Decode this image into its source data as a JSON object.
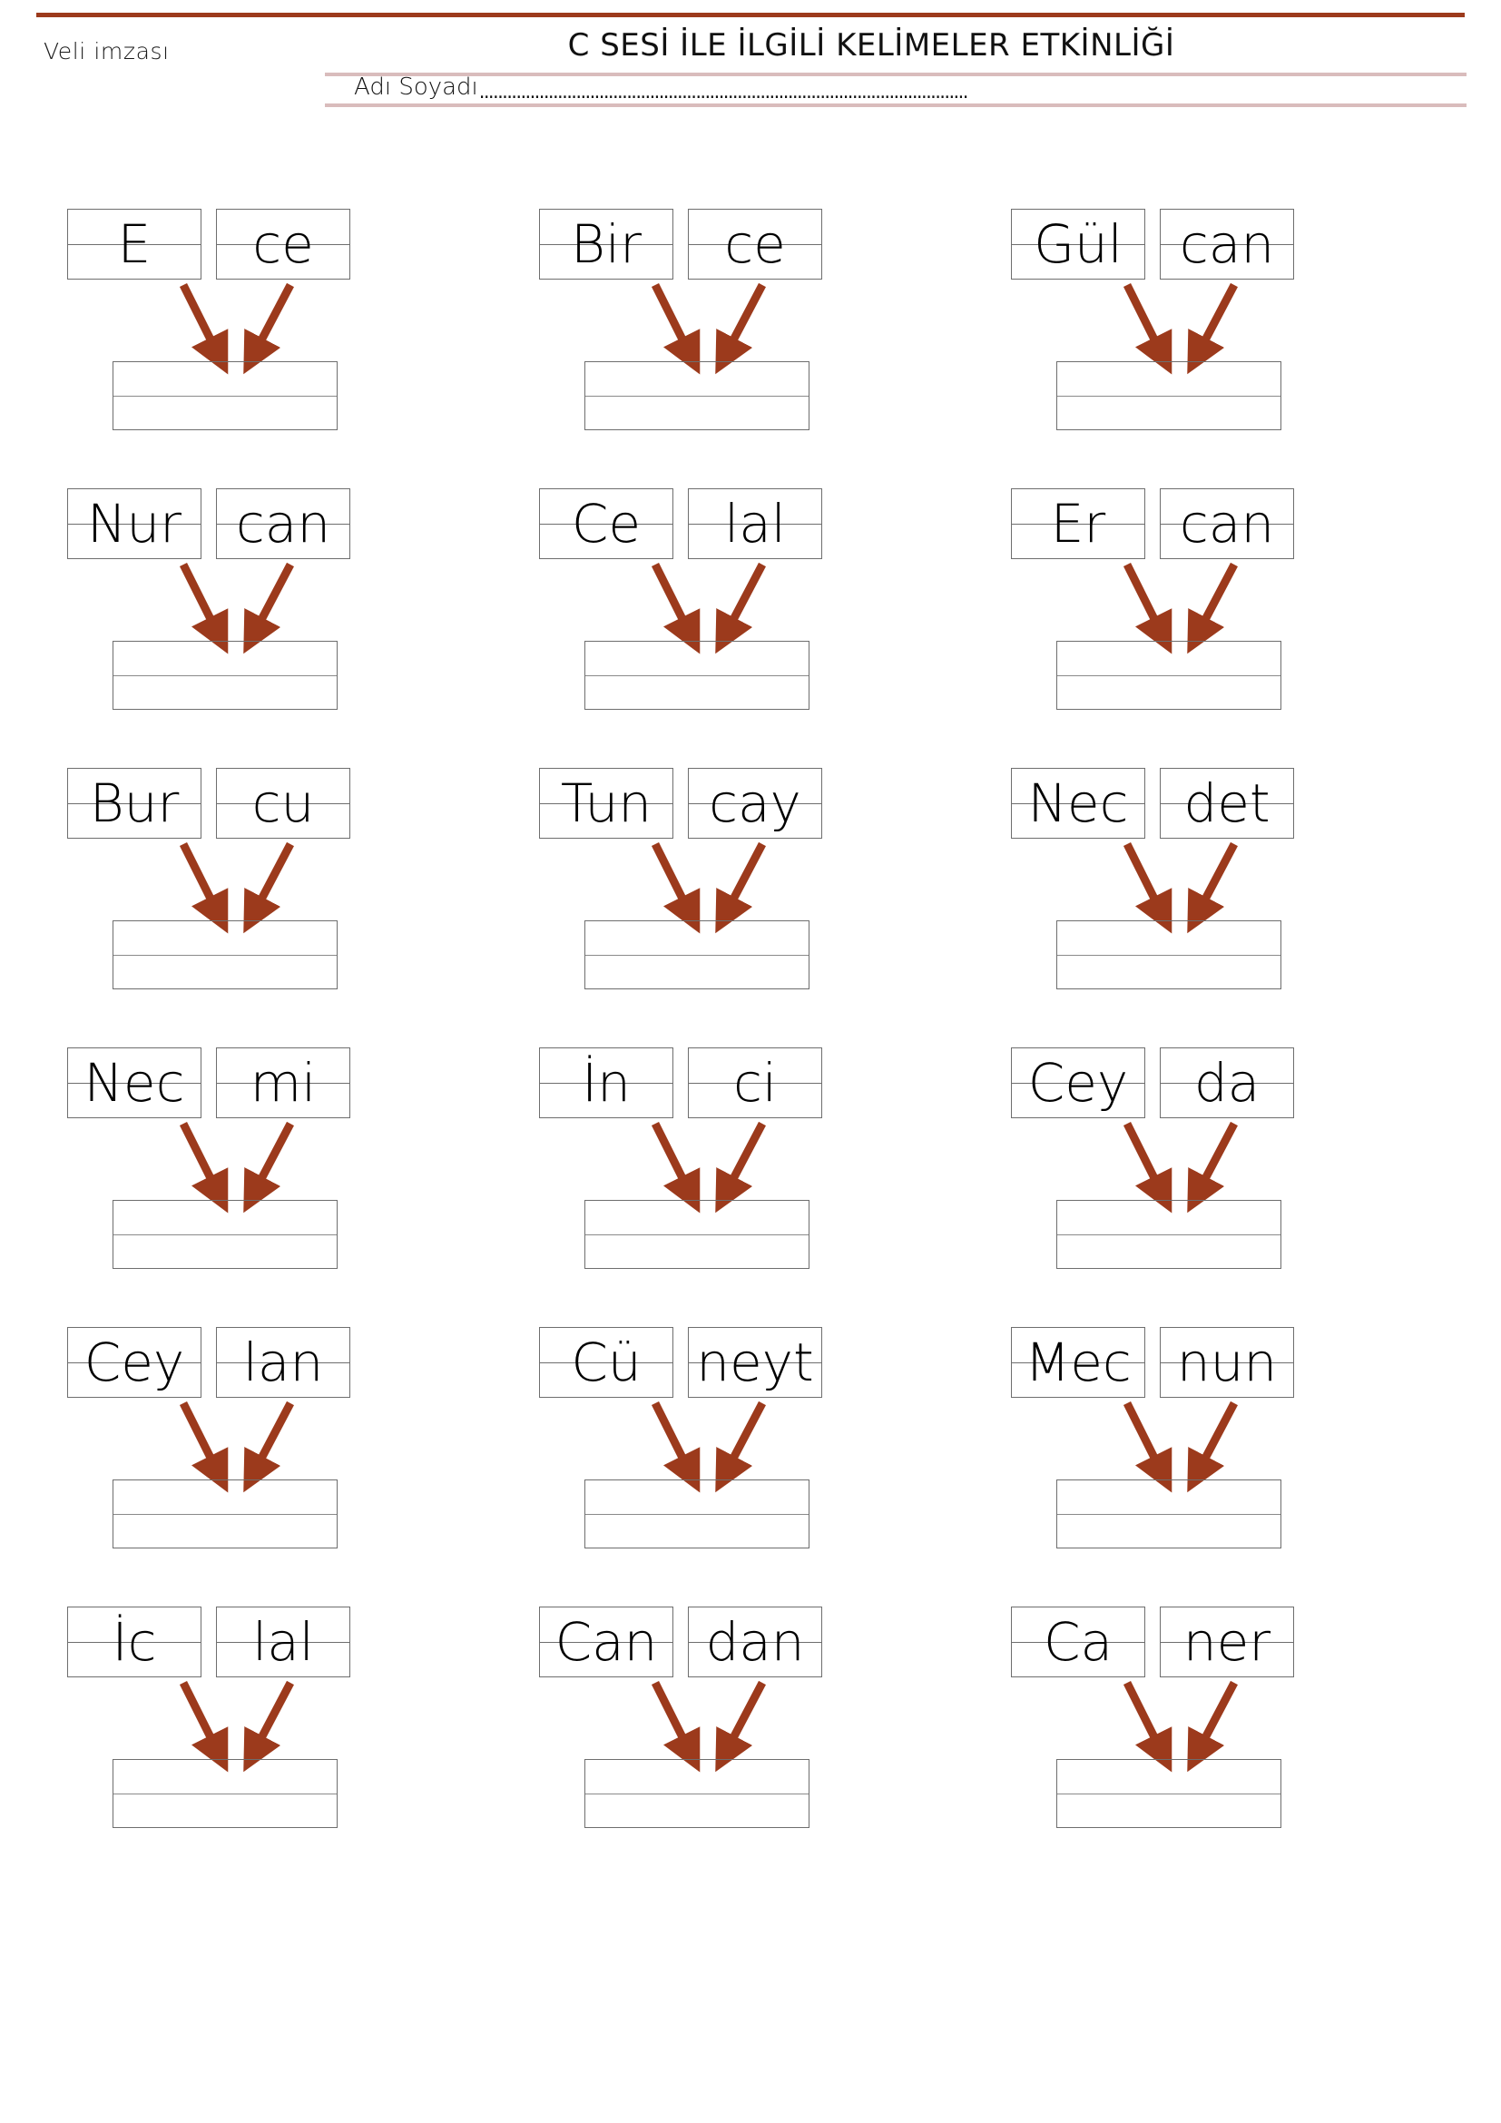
{
  "header": {
    "parent_signature_label": "Veli imzası",
    "title": "C SESİ İLE İLGİLİ KELİMELER ETKİNLİĞİ",
    "name_label": "Adı Soyadı",
    "name_dots": "..........................................................................................................",
    "rule_color": "#9c3a1c",
    "pink_rule_color": "#d9bcbc"
  },
  "exercises": [
    {
      "left": "E",
      "right": "ce",
      "answer": ""
    },
    {
      "left": "Bir",
      "right": "ce",
      "answer": ""
    },
    {
      "left": "Gül",
      "right": "can",
      "answer": ""
    },
    {
      "left": "Nur",
      "right": "can",
      "answer": ""
    },
    {
      "left": "Ce",
      "right": "lal",
      "answer": ""
    },
    {
      "left": "Er",
      "right": "can",
      "answer": ""
    },
    {
      "left": "Bur",
      "right": "cu",
      "answer": ""
    },
    {
      "left": "Tun",
      "right": "cay",
      "answer": ""
    },
    {
      "left": "Nec",
      "right": "det",
      "answer": ""
    },
    {
      "left": "Nec",
      "right": "mi",
      "answer": ""
    },
    {
      "left": "İn",
      "right": "ci",
      "answer": ""
    },
    {
      "left": "Cey",
      "right": "da",
      "answer": ""
    },
    {
      "left": "Cey",
      "right": "lan",
      "answer": ""
    },
    {
      "left": "Cü",
      "right": "neyt",
      "answer": ""
    },
    {
      "left": "Mec",
      "right": "nun",
      "answer": ""
    },
    {
      "left": "İc",
      "right": "lal",
      "answer": ""
    },
    {
      "left": "Can",
      "right": "dan",
      "answer": ""
    },
    {
      "left": "Ca",
      "right": "ner",
      "answer": ""
    }
  ],
  "style": {
    "arrow_color": "#9c3a1c",
    "box_border_color": "#6e6e6e",
    "text_color": "#000000"
  },
  "layout": {
    "rows": 6,
    "columns": 3
  }
}
